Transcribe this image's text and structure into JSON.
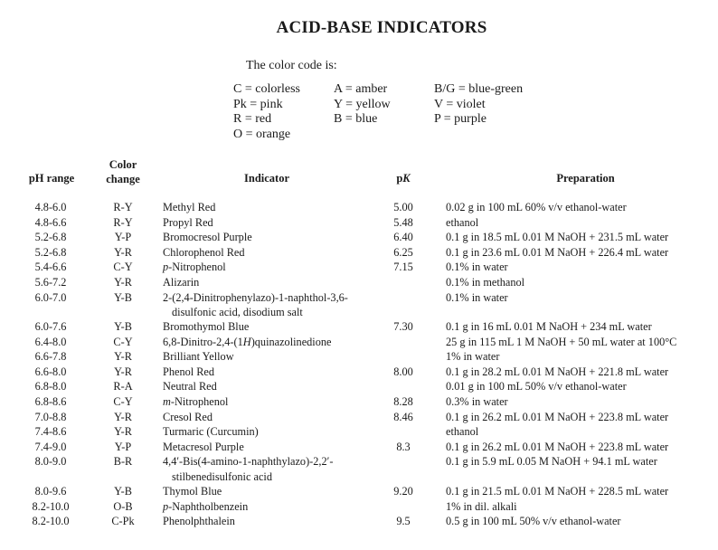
{
  "title": "ACID-BASE INDICATORS",
  "color_code": {
    "intro": "The color code is:",
    "columns": [
      [
        "C = colorless",
        "Pk = pink",
        "R = red",
        "O = orange"
      ],
      [
        "A = amber",
        "Y = yellow",
        "B = blue"
      ],
      [
        "B/G = blue-green",
        "V = violet",
        "P = purple"
      ]
    ]
  },
  "table": {
    "headers": {
      "ph_range": "pH range",
      "color_change_line1": "Color",
      "color_change_line2": "change",
      "indicator": "Indicator",
      "pk_p": "p",
      "pk_k": "K",
      "preparation": "Preparation"
    },
    "rows": [
      {
        "ph": "4.8-6.0",
        "cc": "R-Y",
        "ind_prefix": "",
        "ind": "Methyl Red",
        "ind_cont": "",
        "pk": "5.00",
        "prep": "0.02 g in 100 mL 60% v/v ethanol-water",
        "gap": false
      },
      {
        "ph": "4.8-6.6",
        "cc": "R-Y",
        "ind_prefix": "",
        "ind": "Propyl Red",
        "ind_cont": "",
        "pk": "5.48",
        "prep": "ethanol",
        "gap": false
      },
      {
        "ph": "5.2-6.8",
        "cc": "Y-P",
        "ind_prefix": "",
        "ind": "Bromocresol Purple",
        "ind_cont": "",
        "pk": "6.40",
        "prep": "0.1 g in 18.5 mL 0.01 M NaOH + 231.5 mL water",
        "gap": false
      },
      {
        "ph": "5.2-6.8",
        "cc": "Y-R",
        "ind_prefix": "",
        "ind": "Chlorophenol Red",
        "ind_cont": "",
        "pk": "6.25",
        "prep": "0.1 g in 23.6 mL 0.01 M NaOH + 226.4 mL water",
        "gap": false
      },
      {
        "ph": "5.4-6.6",
        "cc": "C-Y",
        "ind_prefix": "p",
        "ind": "-Nitrophenol",
        "ind_cont": "",
        "pk": "7.15",
        "prep": "0.1% in water",
        "gap": false
      },
      {
        "ph": "5.6-7.2",
        "cc": "Y-R",
        "ind_prefix": "",
        "ind": "Alizarin",
        "ind_cont": "",
        "pk": "",
        "prep": "0.1% in methanol",
        "gap": false
      },
      {
        "ph": "6.0-7.0",
        "cc": "Y-B",
        "ind_prefix": "",
        "ind": "2-(2,4-Dinitrophenylazo)-1-naphthol-3,6-",
        "ind_cont": "disulfonic acid, disodium salt",
        "pk": "",
        "prep": "0.1% in water",
        "gap": true
      },
      {
        "ph": "6.0-7.6",
        "cc": "Y-B",
        "ind_prefix": "",
        "ind": "Bromothymol Blue",
        "ind_cont": "",
        "pk": "7.30",
        "prep": "0.1 g in 16 mL 0.01 M NaOH + 234 mL water",
        "gap": false
      },
      {
        "ph": "6.4-8.0",
        "cc": "C-Y",
        "ind_prefix": "",
        "ind": "6,8-Dinitro-2,4-(1H)quinazolinedione",
        "ind_cont": "",
        "pk": "",
        "prep": "25 g in 115 mL 1 M NaOH + 50 mL water at 100°C",
        "gap": false
      },
      {
        "ph": "6.6-7.8",
        "cc": "Y-R",
        "ind_prefix": "",
        "ind": "Brilliant Yellow",
        "ind_cont": "",
        "pk": "",
        "prep": "1% in water",
        "gap": false
      },
      {
        "ph": "6.6-8.0",
        "cc": "Y-R",
        "ind_prefix": "",
        "ind": "Phenol Red",
        "ind_cont": "",
        "pk": "8.00",
        "prep": "0.1 g in 28.2 mL 0.01 M NaOH + 221.8 mL water",
        "gap": false
      },
      {
        "ph": "6.8-8.0",
        "cc": "R-A",
        "ind_prefix": "",
        "ind": "Neutral Red",
        "ind_cont": "",
        "pk": "",
        "prep": "0.01 g in 100 mL 50% v/v ethanol-water",
        "gap": false
      },
      {
        "ph": "6.8-8.6",
        "cc": "C-Y",
        "ind_prefix": "m",
        "ind": "-Nitrophenol",
        "ind_cont": "",
        "pk": "8.28",
        "prep": "0.3% in water",
        "gap": false
      },
      {
        "ph": "7.0-8.8",
        "cc": "Y-R",
        "ind_prefix": "",
        "ind": "Cresol Red",
        "ind_cont": "",
        "pk": "8.46",
        "prep": "0.1 g in 26.2 mL 0.01 M NaOH + 223.8 mL water",
        "gap": false
      },
      {
        "ph": "7.4-8.6",
        "cc": "Y-R",
        "ind_prefix": "",
        "ind": "Turmaric (Curcumin)",
        "ind_cont": "",
        "pk": "",
        "prep": "ethanol",
        "gap": false
      },
      {
        "ph": "7.4-9.0",
        "cc": "Y-P",
        "ind_prefix": "",
        "ind": "Metacresol Purple",
        "ind_cont": "",
        "pk": "8.3",
        "prep": "0.1 g in 26.2 mL 0.01 M NaOH + 223.8 mL water",
        "gap": false
      },
      {
        "ph": "8.0-9.0",
        "cc": "B-R",
        "ind_prefix": "",
        "ind": "4,4′-Bis(4-amino-1-naphthylazo)-2,2′-",
        "ind_cont": "stilbenedisulfonic acid",
        "pk": "",
        "prep": "0.1 g in 5.9 mL 0.05 M NaOH + 94.1 mL water",
        "gap": true
      },
      {
        "ph": "8.0-9.6",
        "cc": "Y-B",
        "ind_prefix": "",
        "ind": "Thymol Blue",
        "ind_cont": "",
        "pk": "9.20",
        "prep": "0.1 g in 21.5 mL 0.01 M NaOH + 228.5 mL water",
        "gap": false
      },
      {
        "ph": "8.2-10.0",
        "cc": "O-B",
        "ind_prefix": "p",
        "ind": "-Naphtholbenzein",
        "ind_cont": "",
        "pk": "",
        "prep": "1% in dil. alkali",
        "gap": false
      },
      {
        "ph": "8.2-10.0",
        "cc": "C-Pk",
        "ind_prefix": "",
        "ind": "Phenolphthalein",
        "ind_cont": "",
        "pk": "9.5",
        "prep": "0.5 g in 100 mL 50% v/v ethanol-water",
        "gap": false
      }
    ]
  }
}
